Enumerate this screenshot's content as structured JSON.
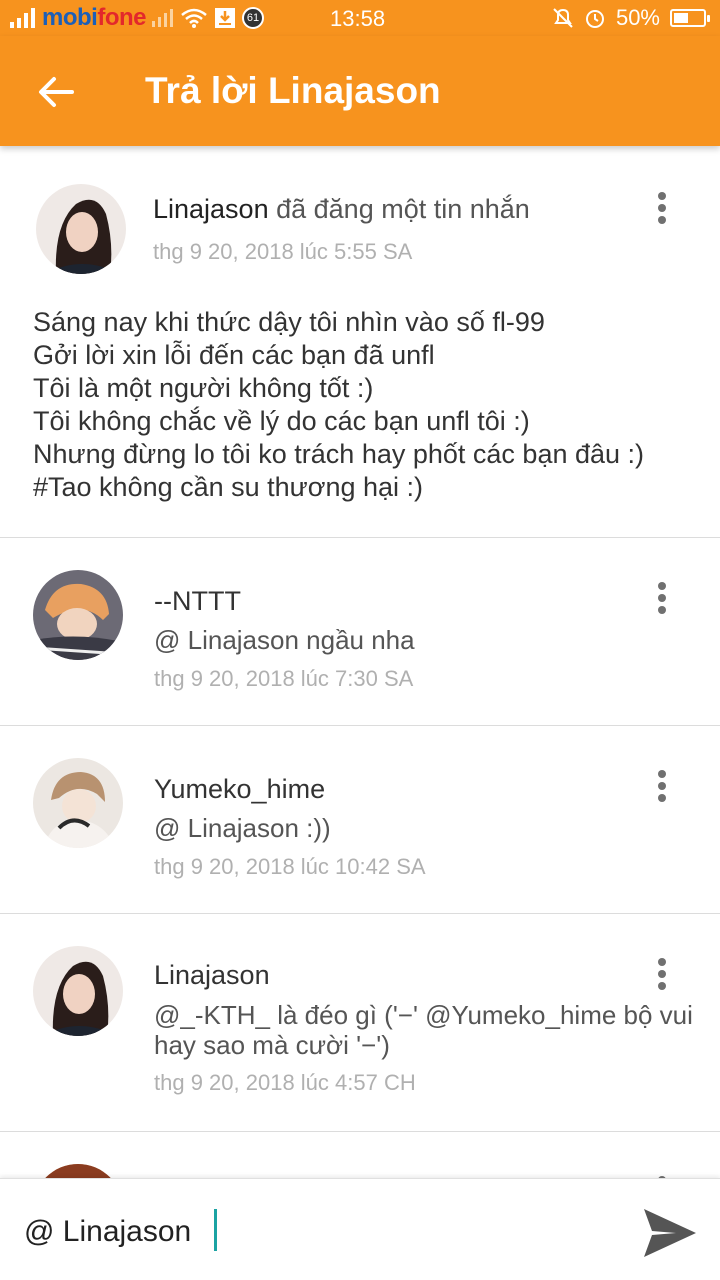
{
  "status_bar": {
    "carrier_part1": "mobi",
    "carrier_part2": "fone",
    "notification_badge": "61",
    "time": "13:58",
    "battery_text": "50%",
    "battery_level": 0.5
  },
  "app_bar": {
    "title": "Trả lời Linajason"
  },
  "post": {
    "author": "Linajason",
    "action": "đã đăng một tin nhắn",
    "date": "thg 9 20, 2018 lúc 5:55 SA",
    "body_lines": [
      "Sáng nay khi thức dậy tôi nhìn vào số fl-99",
      "Gởi lời xin lỗi đến các bạn đã unfl",
      "Tôi là một người không tốt :)",
      "Tôi không chắc về lý do các bạn unfl tôi :)",
      "Nhưng đừng lo tôi ko trách hay phốt các bạn đâu :)",
      "#Tao không cần su thương hại :)"
    ]
  },
  "comments": [
    {
      "name": "--NTTT",
      "text": "@ Linajason  ngầu nha",
      "date": "thg 9 20, 2018 lúc 7:30 SA"
    },
    {
      "name": "Yumeko_hime",
      "text": "@ Linajason :))",
      "date": "thg 9 20, 2018 lúc 10:42 SA"
    },
    {
      "name": "Linajason",
      "text": "@_-KTH_ là đéo gì ('−' @Yumeko_hime bộ vui hay sao mà cười '−')",
      "date": "thg 9 20, 2018 lúc 4:57 CH"
    }
  ],
  "reply_input": {
    "value": "@ Linajason "
  },
  "colors": {
    "accent": "#f7931e",
    "caret": "#1ba3a3"
  }
}
